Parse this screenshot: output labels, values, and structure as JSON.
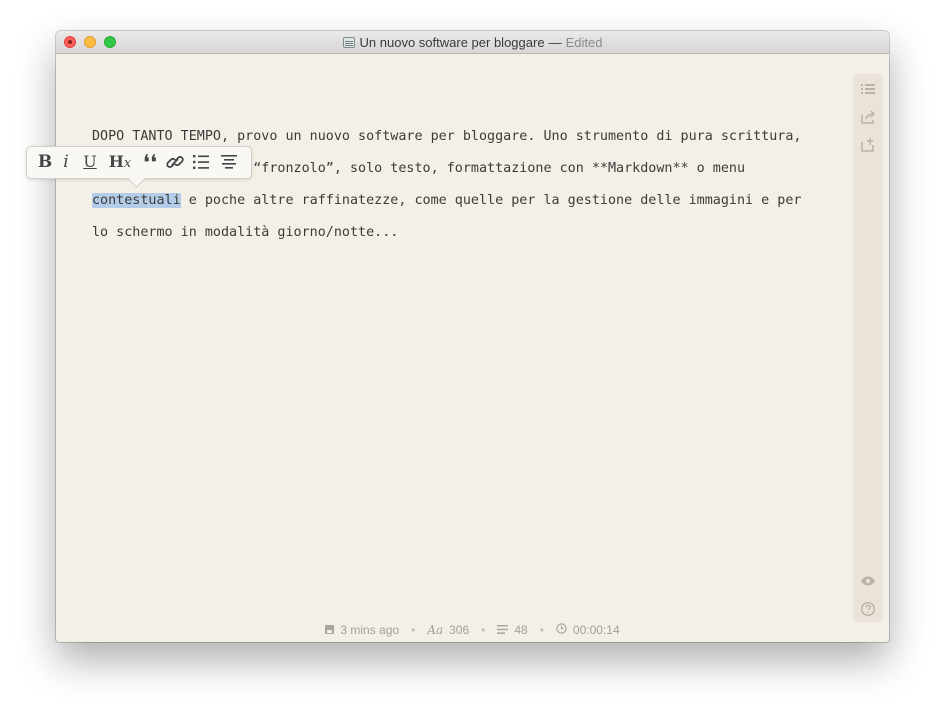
{
  "window": {
    "title": "Un nuovo software per bloggare",
    "separator": "—",
    "status": "Edited"
  },
  "editor": {
    "lines": [
      "DOPO TANTO TEMPO, provo un nuovo software per bloggare. Uno strumento di pura scrittura,",
      "senza alcun tipo di “fronzolo”, solo testo, formattazione con **Markdown** o menu",
      " e poche altre raffinatezze, come quelle per la gestione delle immagini e per",
      "lo schermo in modalità giorno/notte..."
    ],
    "selected_word": "contestuali"
  },
  "format_toolbar": {
    "bold": "B",
    "italic": "i",
    "underline": "U",
    "heading": "H",
    "heading_sub": "x",
    "quote": "❛❛"
  },
  "statusbar": {
    "saved": "3 mins ago",
    "font_icon": "Aa",
    "characters": "306",
    "words": "48",
    "time": "00:00:14"
  },
  "icons": {
    "sidebar_top": [
      "outline-list-icon",
      "share-icon",
      "export-icon"
    ],
    "sidebar_bottom": [
      "preview-eye-icon",
      "help-icon"
    ]
  }
}
